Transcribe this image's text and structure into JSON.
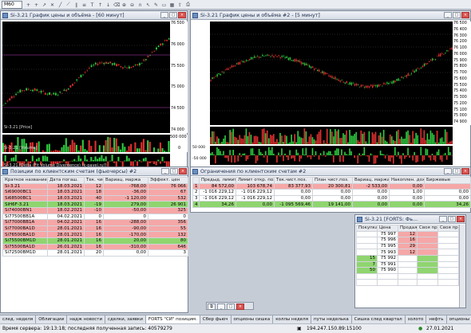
{
  "toolbar": {
    "interval": "M60",
    "icons": [
      "plus-icon",
      "plus-icon",
      "arrow-icon",
      "cross-icon",
      "line-icon",
      "ray-icon",
      "channel-icon",
      "fibo-icon",
      "text-icon",
      "arrow-up-icon",
      "arrow-down-icon",
      "eraser-icon",
      "zoom-in-icon",
      "zoom-out-icon",
      "magnet-icon",
      "pointer-icon",
      "pencil-icon",
      "shape-icon",
      "grid-icon",
      "export-icon",
      "print-icon"
    ]
  },
  "chart1": {
    "title": "Si-3.21 График цены и объёма - [60 минут]",
    "price_label": "Si-3.21 [Price]",
    "volume_label": "Si-3.21 [Volume]",
    "indicator_label": "Si-3.21 [Delta (Fit Volume Divergence) [k-pavel.ru]]",
    "price_ticks": [
      "76 500",
      "76 000",
      "75 500",
      "75 000",
      "74 500",
      "74 000"
    ],
    "last_price_tag": "75 986",
    "volume_ticks": [
      "500 000",
      "0"
    ],
    "indicator_ticks": [
      "50 000",
      "0",
      "-50 000"
    ],
    "x_ticks": [
      "22",
      "25",
      "26",
      "27"
    ]
  },
  "chart2": {
    "title": "Si-3.21 График цены и объёма #2 - [5 минут]",
    "price_ticks": [
      "76 500",
      "76 400",
      "76 300",
      "76 200",
      "76 100",
      "76 000",
      "75 900",
      "75 800",
      "75 700",
      "75 600",
      "75 500",
      "75 400",
      "75 300",
      "75 200",
      "75 100",
      "75 000",
      "74 900"
    ],
    "last_price_tag": "75 986",
    "volume_ticks": [
      "50 000",
      "0"
    ],
    "indicator_ticks": [
      "50 000",
      "0",
      "-50 000"
    ],
    "x_ticks": [
      "10h",
      "13h",
      "16h",
      "19h",
      "22h",
      "11h",
      "14h",
      "17h",
      "20h",
      "23h",
      "12h",
      "15h",
      "18h"
    ]
  },
  "positions": {
    "title": "Позиции по клиентским счетам (фьючерсы) #2",
    "columns": [
      "Краткое название",
      "Дата погаш.",
      "Тек. чист.",
      "Вариац. маржа",
      "Эффект. цен"
    ],
    "rows": [
      {
        "c": [
          "Si-3.21",
          "18.03.2021",
          "12",
          "-768,00",
          "76 066"
        ],
        "s": "rowp"
      },
      {
        "c": [
          "Si69000BC1",
          "18.03.2021",
          "18",
          "-36,00",
          "67"
        ],
        "s": "rowp"
      },
      {
        "c": [
          "Si68500BC1",
          "18.03.2021",
          "40",
          "-1 120,00",
          "532"
        ],
        "s": "rowp"
      },
      {
        "c": [
          "SiH6F-3.21",
          "18.03.2021",
          "-19",
          "279,00",
          "26 901"
        ],
        "s": "rowg"
      },
      {
        "c": [
          "Si74000BN1",
          "18.02.2021",
          "-10",
          "-50,00",
          "325"
        ],
        "s": "rowp"
      },
      {
        "c": [
          "Si77500BB1A",
          "04.02.2021",
          "0",
          "0",
          "0"
        ],
        "s": "rowy"
      },
      {
        "c": [
          "Si77000BB1A",
          "04.02.2021",
          "16",
          "-288,00",
          "356"
        ],
        "s": "rowp"
      },
      {
        "c": [
          "Si77000BA1D",
          "28.01.2021",
          "16",
          "-90,00",
          "55"
        ],
        "s": "rowp"
      },
      {
        "c": [
          "Si76500BA1D",
          "28.01.2021",
          "16",
          "-170,00",
          "132"
        ],
        "s": "rowp"
      },
      {
        "c": [
          "Si75500BM1D",
          "28.01.2021",
          "16",
          "20,00",
          "80"
        ],
        "s": "rowg"
      },
      {
        "c": [
          "Si75500BA1D",
          "26.01.2021",
          "16",
          "-310,00",
          "646"
        ],
        "s": "rowp"
      },
      {
        "c": [
          "Si72500BM1D",
          "28.01.2021",
          "20",
          "0,00",
          "3"
        ],
        "s": "rowy"
      }
    ]
  },
  "limits": {
    "title": "Ограничения по клиентским счетам #2",
    "columns": [
      "",
      "Предыд. лимит",
      "Лимит откр. поз.",
      "Тек.чист.поз.",
      "План чист.поз.",
      "Вариац. маржа",
      "Накоплен. доход",
      "Биржевые"
    ],
    "rows": [
      {
        "c": [
          "1",
          "84 572,00",
          "103 678,74",
          "83 377,93",
          "20 300,81",
          "-2 533,00",
          "0,00",
          ""
        ],
        "s": "rowp"
      },
      {
        "c": [
          "2",
          "-1 016 229,12",
          "-1 016 229,12",
          "0,00",
          "0,00",
          "0,00",
          "1,00",
          "0,00"
        ],
        "s": "rowy"
      },
      {
        "c": [
          "3",
          "-1 016 229,12",
          "-1 016 229,12",
          "0,00",
          "0,00",
          "0,00",
          "0,00",
          "0,00"
        ],
        "s": "rowy"
      },
      {
        "c": [
          "4",
          "34,26",
          "0,00",
          "-1 095 569,46",
          "19 141,00",
          "0,00",
          "0,00",
          "34,26"
        ],
        "s": "rowg"
      }
    ]
  },
  "orderbook": {
    "title": "Si-3.21 [FORTS: Фь...",
    "columns": [
      "Покупка",
      "Цена",
      "Продажа",
      "Своя пр",
      "Своя пр"
    ],
    "rows": [
      {
        "buy": "",
        "price": "75 997",
        "sell": "12"
      },
      {
        "buy": "",
        "price": "75 996",
        "sell": "16"
      },
      {
        "buy": "",
        "price": "75 995",
        "sell": "29"
      },
      {
        "buy": "",
        "price": "75 993",
        "sell": "12"
      },
      {
        "buy": "15",
        "price": "75 992",
        "sell": ""
      },
      {
        "buy": "7",
        "price": "75 991",
        "sell": ""
      },
      {
        "buy": "50",
        "price": "75 990",
        "sell": ""
      },
      {
        "buy": "",
        "price": "",
        "sell": ""
      },
      {
        "buy": "",
        "price": "",
        "sell": ""
      }
    ]
  },
  "bottom_tabs": [
    "след. неделя",
    "Облигации",
    "надж новости",
    "сделки, заявки",
    "FORTS \"СИ\" позицим.",
    "Сбер фьюч",
    "опционы сишка",
    "коллы неделя",
    "путы неделька",
    "Сишка след квартал",
    "золото",
    "нефть",
    "опционы ртс"
  ],
  "status": {
    "server_time": "Время сервера: 19:13:18; последняя полученная запись: 40579279",
    "ip": "194.247.150.89:15100",
    "date": "27.01.2021"
  },
  "colors": {
    "profit": "#8fd56f",
    "loss": "#f5a7a7",
    "chart_bg": "#000000",
    "up_candle": "#2ecc40",
    "down_candle": "#e03030"
  }
}
